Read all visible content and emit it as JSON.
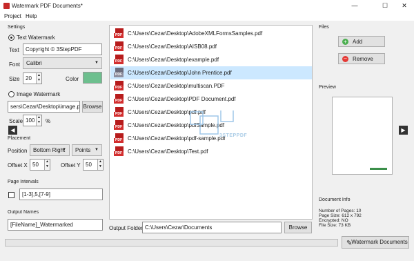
{
  "window": {
    "title": "Watermark PDF Documents*",
    "minimize_glyph": "—",
    "maximize_glyph": "☐",
    "close_glyph": "✕"
  },
  "menu": {
    "items": [
      "Project",
      "Help"
    ]
  },
  "settings": {
    "group_label": "Settings",
    "text_watermark_label": "Text Watermark",
    "text_label": "Text",
    "text_value": "Copyright © 3StepPDF",
    "font_label": "Font",
    "font_value": "Calibri",
    "size_label": "Size",
    "size_value": "20",
    "color_label": "Color",
    "color_value": "#6dbf8e",
    "image_watermark_label": "Image Watermark",
    "image_path_value": "sers\\Cezar\\Desktop\\image.png",
    "browse_label": "Browse",
    "scale_label": "Scale",
    "scale_value": "100",
    "scale_unit": "%",
    "selected_mode": "text"
  },
  "placement": {
    "group_label": "Placement",
    "position_label": "Position",
    "position_value": "Bottom Right",
    "unit_value": "Points",
    "offset_x_label": "Offset X",
    "offset_x_value": "50",
    "offset_y_label": "Offset Y",
    "offset_y_value": "50"
  },
  "page_intervals": {
    "group_label": "Page Intervals",
    "value": "[1-3],5,[7-9]",
    "checked": false
  },
  "output_names": {
    "group_label": "Output Names",
    "value": "[FileName]_Watermarked"
  },
  "files_list": {
    "items": [
      "C:\\Users\\Cezar\\Desktop\\AdobeXMLFormsSamples.pdf",
      "C:\\Users\\Cezar\\Desktop\\AISB08.pdf",
      "C:\\Users\\Cezar\\Desktop\\example.pdf",
      "C:\\Users\\Cezar\\Desktop\\John Prentice.pdf",
      "C:\\Users\\Cezar\\Desktop\\multiscan.PDF",
      "C:\\Users\\Cezar\\Desktop\\PDF Document.pdf",
      "C:\\Users\\Cezar\\Desktop\\pdf.pdf",
      "C:\\Users\\Cezar\\Desktop\\pdfSample.pdf",
      "C:\\Users\\Cezar\\Desktop\\pdf-sample.pdf",
      "C:\\Users\\Cezar\\Desktop\\Test.pdf"
    ],
    "selected_index": 3,
    "icon_tag": "PDF"
  },
  "output_folder": {
    "label": "Output Folder",
    "value": "C:\\Users\\Cezar\\Documents",
    "browse_label": "Browse"
  },
  "files_panel": {
    "group_label": "Files",
    "add_label": "Add",
    "remove_label": "Remove"
  },
  "preview": {
    "group_label": "Preview"
  },
  "document_info": {
    "group_label": "Document Info",
    "pages": "Number of Pages: 10",
    "page_size": "Page Size: 612 x 792",
    "encrypted": "Encrypted: NO",
    "file_size": "File Size: 73 KB"
  },
  "watermark_button_label": "Watermark Documents",
  "watermark_overlay_text": "3STEPPDF",
  "colors": {
    "accent_green": "#6dbf8e",
    "pdf_red": "#d32f2f",
    "selection": "#cce8ff"
  }
}
